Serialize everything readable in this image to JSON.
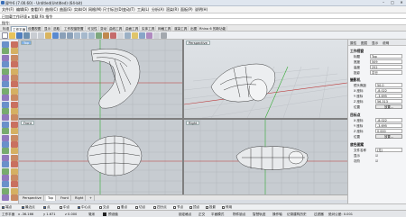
{
  "window": {
    "title": "犀牛6 (7.00.60) - Untitled(Untitled) (64-bit)",
    "minimize": "–",
    "maximize": "□",
    "close": "✕"
  },
  "menu": [
    "文件(F)",
    "编辑(E)",
    "查看(V)",
    "曲线(C)",
    "曲面(S)",
    "实体(O)",
    "网格(M)",
    "尺寸标注(D)",
    "变动(T)",
    "工具(L)",
    "分析(A)",
    "渲染(R)",
    "面板(P)",
    "说明(H)"
  ],
  "command": {
    "history": "已加载工作环境    ▸ 加载 Rh 指令",
    "prompt_label": "指令:",
    "prompt_value": ""
  },
  "tabs": [
    "标准",
    "工作平面",
    "设置视图",
    "显示",
    "选取",
    "工作视窗配置",
    "可见性",
    "变动",
    "曲线工具",
    "曲面工具",
    "实体工具",
    "网格工具",
    "渲染工具",
    "出图",
    "Rhino 6 的新功能"
  ],
  "active_tab_index": 1,
  "viewports": {
    "top": "Top",
    "perspective": "Perspective",
    "front": "Front",
    "right": "Right"
  },
  "viewport_tabs": [
    "Perspective",
    "Top",
    "Front",
    "Right"
  ],
  "viewport_tab_add": "+",
  "osnap": {
    "items": [
      {
        "label": "端点",
        "on": true
      },
      {
        "label": "最近点",
        "on": true
      },
      {
        "label": "点",
        "on": true
      },
      {
        "label": "中点",
        "on": false
      },
      {
        "label": "中心点",
        "on": true
      },
      {
        "label": "交点",
        "on": false
      },
      {
        "label": "垂点",
        "on": false
      },
      {
        "label": "切点",
        "on": false
      },
      {
        "label": "四分点",
        "on": false
      },
      {
        "label": "节点",
        "on": false
      },
      {
        "label": "顶点",
        "on": false
      },
      {
        "label": "投影",
        "on": false
      },
      {
        "label": "停用",
        "on": false
      }
    ]
  },
  "status": {
    "plane": "工作平面",
    "x": "x -36.166",
    "y": "y 1.671",
    "z": "z 0.000",
    "units": "毫米",
    "layer": "预设值",
    "items": [
      "锁定格点",
      "正交",
      "平面模式",
      "物件锁点",
      "智慧轨迹",
      "操作轴",
      "记录建构历史",
      "过滤器",
      "绝对公差: 0.001"
    ]
  },
  "panel": {
    "tabs": [
      "属性",
      "图层",
      "显示",
      "说明"
    ],
    "section_viewport": "工作视窗",
    "fields": [
      {
        "label": "标题",
        "value": "Top"
      },
      {
        "label": "宽度",
        "value": "509"
      },
      {
        "label": "高度",
        "value": "252"
      },
      {
        "label": "投影",
        "value": "平行"
      }
    ],
    "section_camera": "摄影机",
    "camera_fields": [
      {
        "label": "镜头焦距",
        "value": "50.0"
      },
      {
        "label": "X 座标",
        "value": "-8.022"
      },
      {
        "label": "Y 座标",
        "value": "-3.695"
      },
      {
        "label": "Z 座标",
        "value": "56.313"
      },
      {
        "label": "位置",
        "value": "放置..."
      }
    ],
    "section_target": "目标点",
    "target_fields": [
      {
        "label": "X 座标",
        "value": "-8.022"
      },
      {
        "label": "Y 座标",
        "value": "-3.695"
      },
      {
        "label": "Z 座标",
        "value": "0.000"
      },
      {
        "label": "位置",
        "value": "放置..."
      }
    ],
    "section_wallpaper": "底色图案",
    "wallpaper_fields": [
      {
        "label": "文件名称",
        "value": "(无)"
      },
      {
        "label": "显示",
        "value": "☑"
      },
      {
        "label": "灰阶",
        "value": "☑"
      }
    ]
  },
  "colors": {
    "viewport_bg": "#c7ccd1",
    "grid": "#b2b7bc",
    "axis_x": "#b33",
    "axis_y": "#3a3",
    "active_label": "#7fb0e6"
  }
}
